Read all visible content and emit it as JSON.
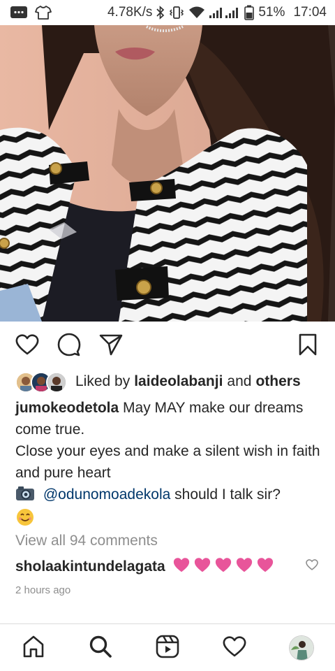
{
  "status_bar": {
    "speed": "4.78K/s",
    "battery": "51%",
    "time": "17:04",
    "icons": [
      "message-icon",
      "tshirt-icon",
      "bluetooth-icon",
      "vibrate-icon",
      "wifi-icon",
      "signal-icon",
      "battery-icon"
    ]
  },
  "post": {
    "image_alt": "Post photo of woman in black and white chevron jacket",
    "liked_by_prefix": "Liked by",
    "liked_by_user": "laideolabanji",
    "liked_by_and": "and",
    "liked_by_others": "others",
    "caption_user": "jumokeodetola",
    "caption_line1": "May MAY make our dreams come true.",
    "caption_line2": "Close your eyes and make a silent wish in faith and pure heart",
    "camera_emoji": "camera-icon",
    "mention": "@odunomoadekola",
    "caption_line3_rest": "should I talk sir?",
    "smile_emoji": "smiling-face-icon",
    "view_all_comments": "View all 94 comments",
    "comment_user": "sholaakintundelagata",
    "comment_hearts": 5,
    "time_ago": "2 hours ago"
  },
  "colors": {
    "text": "#262626",
    "muted": "#8e8e8e",
    "mention": "#00376b",
    "heart_pink": "#e8559a"
  }
}
